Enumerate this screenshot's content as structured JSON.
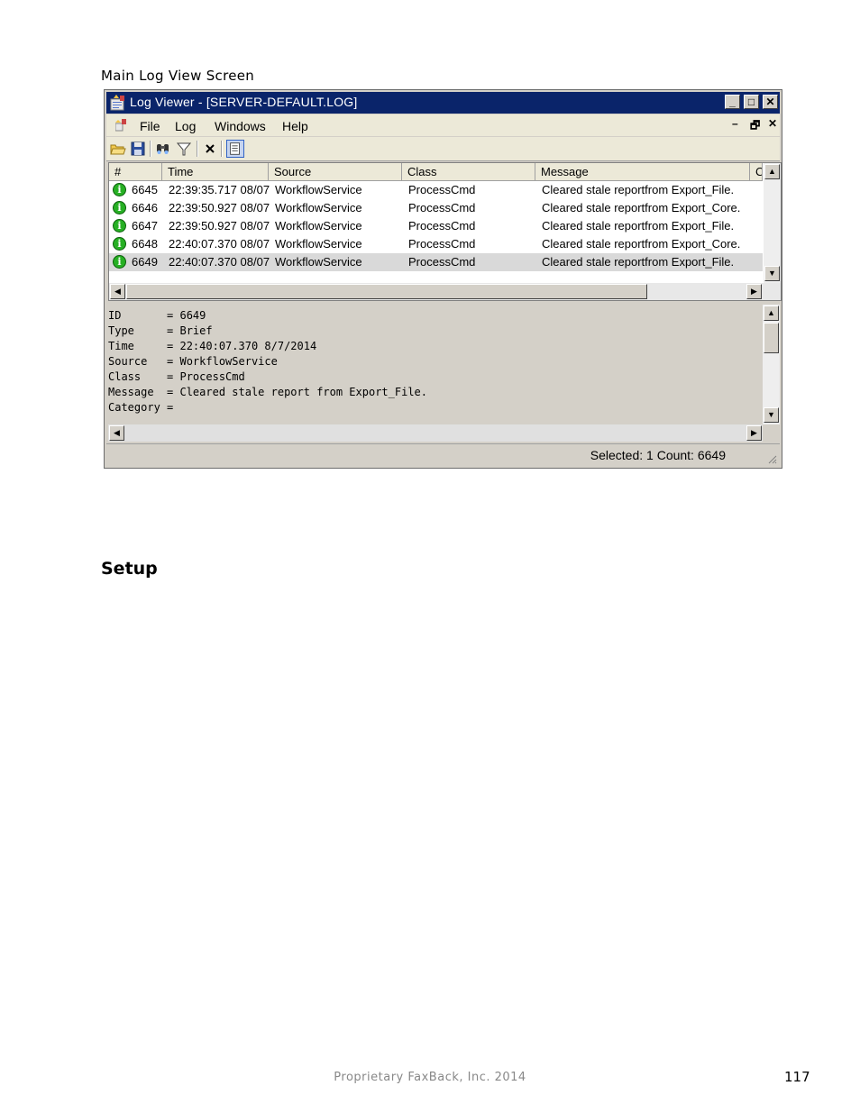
{
  "caption": "Main Log View Screen",
  "window": {
    "title": "Log Viewer - [SERVER-DEFAULT.LOG]",
    "controls": {
      "minimize": "_",
      "maximize": "□",
      "close": "✕"
    }
  },
  "menu": {
    "items": [
      {
        "label": "File"
      },
      {
        "label": "Log"
      },
      {
        "label": "Windows"
      },
      {
        "label": "Help"
      }
    ],
    "mdi_controls": {
      "minimize": "–",
      "restore": "🗗",
      "close": "✕"
    }
  },
  "toolbar": {
    "icons": [
      "open-folder-icon",
      "save-icon",
      "find-icon",
      "filter-icon",
      "delete-icon",
      "details-pane-icon"
    ]
  },
  "list": {
    "columns": [
      "#",
      "Time",
      "Source",
      "Class",
      "Message",
      "C"
    ],
    "rows": [
      {
        "id": "6645",
        "time": "22:39:35.717 08/07",
        "source": "WorkflowService",
        "class": "ProcessCmd",
        "message": "Cleared stale reportfrom Export_File."
      },
      {
        "id": "6646",
        "time": "22:39:50.927 08/07",
        "source": "WorkflowService",
        "class": "ProcessCmd",
        "message": "Cleared stale reportfrom Export_Core."
      },
      {
        "id": "6647",
        "time": "22:39:50.927 08/07",
        "source": "WorkflowService",
        "class": "ProcessCmd",
        "message": "Cleared stale reportfrom Export_File."
      },
      {
        "id": "6648",
        "time": "22:40:07.370 08/07",
        "source": "WorkflowService",
        "class": "ProcessCmd",
        "message": "Cleared stale reportfrom Export_Core."
      },
      {
        "id": "6649",
        "time": "22:40:07.370 08/07",
        "source": "WorkflowService",
        "class": "ProcessCmd",
        "message": "Cleared stale reportfrom Export_File."
      }
    ],
    "selected_row": "6649"
  },
  "details": {
    "lines": [
      "ID       = 6649",
      "Type     = Brief",
      "Time     = 22:40:07.370 8/7/2014",
      "Source   = WorkflowService",
      "Class    = ProcessCmd",
      "Message  = Cleared stale report from Export_File.",
      "Category ="
    ]
  },
  "status": {
    "text": "Selected: 1  Count: 6649"
  },
  "section_heading": "Setup",
  "footer": {
    "text": "Proprietary FaxBack, Inc. 2014",
    "page_number": "117"
  }
}
